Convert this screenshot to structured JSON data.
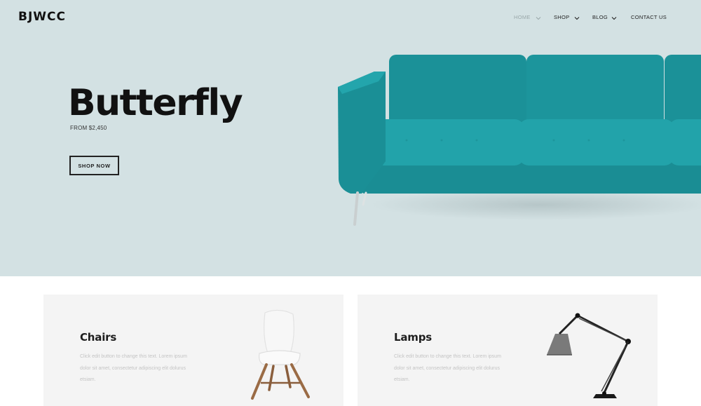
{
  "brand": {
    "logo": "BJWCC"
  },
  "nav": {
    "items": [
      {
        "label": "HOME",
        "active": true,
        "has_dropdown": true
      },
      {
        "label": "SHOP",
        "active": false,
        "has_dropdown": true
      },
      {
        "label": "BLOG",
        "active": false,
        "has_dropdown": true
      },
      {
        "label": "CONTACT US",
        "active": false,
        "has_dropdown": false
      }
    ]
  },
  "hero": {
    "title": "Butterfly",
    "subtitle": "FROM $2,450",
    "cta_label": "SHOP NOW",
    "background_color": "#d3e1e3",
    "product_color": "#1f9aa0",
    "image_icon": "sofa-image"
  },
  "categories": [
    {
      "title": "Chairs",
      "text": "Click edit button to change this text. Lorem ipsum dolor sit amet, consectetur adipiscing elit dolurus etsiam.",
      "image_icon": "chair-image"
    },
    {
      "title": "Lamps",
      "text": "Click edit button to change this text. Lorem ipsum dolor sit amet, consectetur adipiscing elit dolurus etsiam.",
      "image_icon": "lamp-image"
    }
  ]
}
